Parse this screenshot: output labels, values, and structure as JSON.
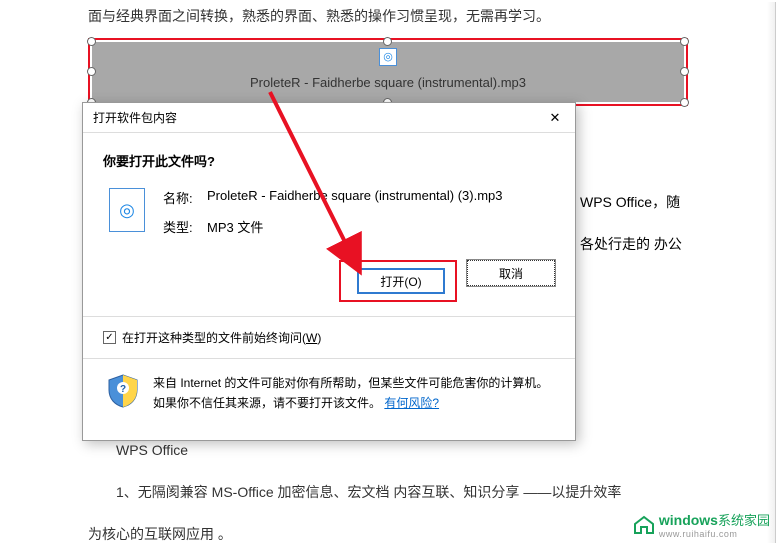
{
  "page": {
    "intro": "面与经典界面之间转换，熟悉的界面、熟悉的操作习惯呈现，无需再学习。",
    "side_text_1": "WPS Office，随",
    "side_text_2": "各处行走的 办公",
    "section_heading": "WPS Office",
    "bullet_1": "1、无隔阂兼容  MS-Office 加密信息、宏文档 内容互联、知识分享 ——以提升效率",
    "bullet_1b": "为核心的互联网应用 。"
  },
  "embed": {
    "filename": "ProleteR - Faidherbe square (instrumental).mp3",
    "icon_glyph": "◎"
  },
  "dialog": {
    "title": "打开软件包内容",
    "question": "你要打开此文件吗?",
    "name_label": "名称:",
    "name_value": "ProleteR - Faidherbe square (instrumental) (3).mp3",
    "type_label": "类型:",
    "type_value": "MP3 文件",
    "open_button": "打开(O)",
    "cancel_button": "取消",
    "checkbox_label_pre": "在打开这种类型的文件前始终询问(",
    "checkbox_hotkey": "W",
    "checkbox_label_post": ")",
    "checkbox_checked": "✓",
    "warning_text_1": "来自 Internet 的文件可能对你有所帮助，但某些文件可能危害你的计算机。如果你不信任其来源，请不要打开该文件。",
    "warning_link": "有何风险?",
    "close_glyph": "✕",
    "file_icon_glyph": "◎"
  },
  "watermark": {
    "brand": "windows",
    "brand_suffix": "系统家园",
    "sub": "www.ruihaifu.com"
  }
}
